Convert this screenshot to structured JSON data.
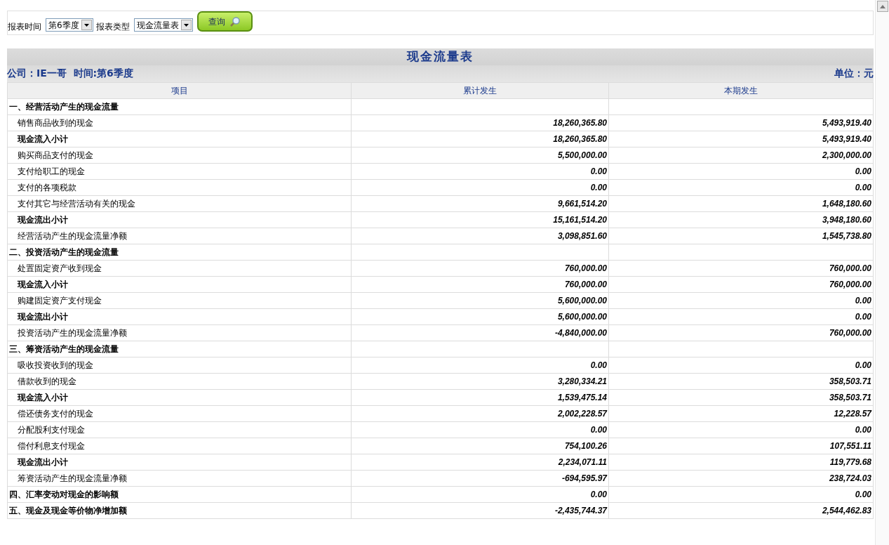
{
  "filters": [
    {
      "label": "报表时间",
      "value": "第6季度"
    },
    {
      "label": "报表类型",
      "value": "现金流量表"
    }
  ],
  "query_button": "查询",
  "report": {
    "title": "现金流量表",
    "company": "公司：IE一哥  时间:第6季度",
    "unit": "单位：元"
  },
  "columns": [
    "项目",
    "累计发生",
    "本期发生"
  ],
  "rows": [
    {
      "kind": "section",
      "item": "一、经营活动产生的现金流量",
      "cumulative": "",
      "current": ""
    },
    {
      "kind": "item",
      "item": "销售商品收到的现金",
      "cumulative": "18,260,365.80",
      "current": "5,493,919.40"
    },
    {
      "kind": "subtotal",
      "item": "现金流入小计",
      "cumulative": "18,260,365.80",
      "current": "5,493,919.40"
    },
    {
      "kind": "item",
      "item": "购买商品支付的现金",
      "cumulative": "5,500,000.00",
      "current": "2,300,000.00"
    },
    {
      "kind": "item",
      "item": "支付给职工的现金",
      "cumulative": "0.00",
      "current": "0.00"
    },
    {
      "kind": "item",
      "item": "支付的各项税款",
      "cumulative": "0.00",
      "current": "0.00"
    },
    {
      "kind": "item",
      "item": "支付其它与经营活动有关的现金",
      "cumulative": "9,661,514.20",
      "current": "1,648,180.60"
    },
    {
      "kind": "subtotal",
      "item": "现金流出小计",
      "cumulative": "15,161,514.20",
      "current": "3,948,180.60"
    },
    {
      "kind": "item",
      "item": "经营活动产生的现金流量净额",
      "cumulative": "3,098,851.60",
      "current": "1,545,738.80"
    },
    {
      "kind": "section",
      "item": "二、投资活动产生的现金流量",
      "cumulative": "",
      "current": ""
    },
    {
      "kind": "item",
      "item": "处置固定资产收到现金",
      "cumulative": "760,000.00",
      "current": "760,000.00"
    },
    {
      "kind": "subtotal",
      "item": "现金流入小计",
      "cumulative": "760,000.00",
      "current": "760,000.00"
    },
    {
      "kind": "item",
      "item": "购建固定资产支付现金",
      "cumulative": "5,600,000.00",
      "current": "0.00"
    },
    {
      "kind": "subtotal",
      "item": "现金流出小计",
      "cumulative": "5,600,000.00",
      "current": "0.00"
    },
    {
      "kind": "item",
      "item": "投资活动产生的现金流量净额",
      "cumulative": "-4,840,000.00",
      "current": "760,000.00"
    },
    {
      "kind": "section",
      "item": "三、筹资活动产生的现金流量",
      "cumulative": "",
      "current": ""
    },
    {
      "kind": "item",
      "item": "吸收投资收到的现金",
      "cumulative": "0.00",
      "current": "0.00"
    },
    {
      "kind": "item",
      "item": "借款收到的现金",
      "cumulative": "3,280,334.21",
      "current": "358,503.71"
    },
    {
      "kind": "subtotal",
      "item": "现金流入小计",
      "cumulative": "1,539,475.14",
      "current": "358,503.71"
    },
    {
      "kind": "item",
      "item": "偿还债务支付的现金",
      "cumulative": "2,002,228.57",
      "current": "12,228.57"
    },
    {
      "kind": "item",
      "item": "分配股利支付现金",
      "cumulative": "0.00",
      "current": "0.00"
    },
    {
      "kind": "item",
      "item": "偿付利息支付现金",
      "cumulative": "754,100.26",
      "current": "107,551.11"
    },
    {
      "kind": "subtotal",
      "item": "现金流出小计",
      "cumulative": "2,234,071.11",
      "current": "119,779.68"
    },
    {
      "kind": "item",
      "item": "筹资活动产生的现金流量净额",
      "cumulative": "-694,595.97",
      "current": "238,724.03"
    },
    {
      "kind": "section",
      "item": "四、汇率变动对现金的影响额",
      "cumulative": "0.00",
      "current": "0.00"
    },
    {
      "kind": "section",
      "item": "五、现金及现金等价物净增加额",
      "cumulative": "-2,435,744.37",
      "current": "2,544,462.83"
    }
  ]
}
